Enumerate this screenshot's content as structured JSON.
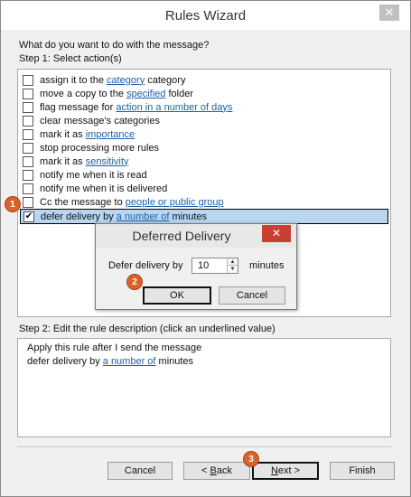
{
  "window": {
    "title": "Rules Wizard",
    "close_symbol": "✕"
  },
  "prompt": "What do you want to do with the message?",
  "step1_label": "Step 1: Select action(s)",
  "actions": [
    {
      "pre": "assign it to the ",
      "link": "category",
      "post": " category",
      "checked": false
    },
    {
      "pre": "move a copy to the ",
      "link": "specified",
      "post": " folder",
      "checked": false
    },
    {
      "pre": "flag message for ",
      "link": "action in a number of days",
      "post": "",
      "checked": false
    },
    {
      "pre": "clear message's categories",
      "link": "",
      "post": "",
      "checked": false
    },
    {
      "pre": "mark it as ",
      "link": "importance",
      "post": "",
      "checked": false
    },
    {
      "pre": "stop processing more rules",
      "link": "",
      "post": "",
      "checked": false
    },
    {
      "pre": "mark it as ",
      "link": "sensitivity",
      "post": "",
      "checked": false
    },
    {
      "pre": "notify me when it is read",
      "link": "",
      "post": "",
      "checked": false
    },
    {
      "pre": "notify me when it is delivered",
      "link": "",
      "post": "",
      "checked": false
    },
    {
      "pre": "Cc the message to ",
      "link": "people or public group",
      "post": "",
      "checked": false
    },
    {
      "pre": "defer delivery by ",
      "link": "a number of",
      "post": " minutes",
      "checked": true
    }
  ],
  "checkmark": "✔",
  "dialog": {
    "title": "Deferred Delivery",
    "close_symbol": "✕",
    "field_label": "Defer delivery by",
    "value": "10",
    "unit": "minutes",
    "ok_label": "OK",
    "cancel_label": "Cancel"
  },
  "step2_label": "Step 2: Edit the rule description (click an underlined value)",
  "description": {
    "line1": "Apply this rule after I send the message",
    "line2_pre": "defer delivery by ",
    "line2_link": "a number of",
    "line2_post": " minutes"
  },
  "footer": {
    "cancel_label": "Cancel",
    "back_label": "< Back",
    "next_label": "Next >",
    "finish_label": "Finish"
  },
  "badges": [
    "1",
    "2",
    "3"
  ],
  "colors": {
    "badge": "#d9632b",
    "link": "#1f5fa8",
    "selection": "#b8d6f2",
    "dialog_close": "#c84032"
  }
}
